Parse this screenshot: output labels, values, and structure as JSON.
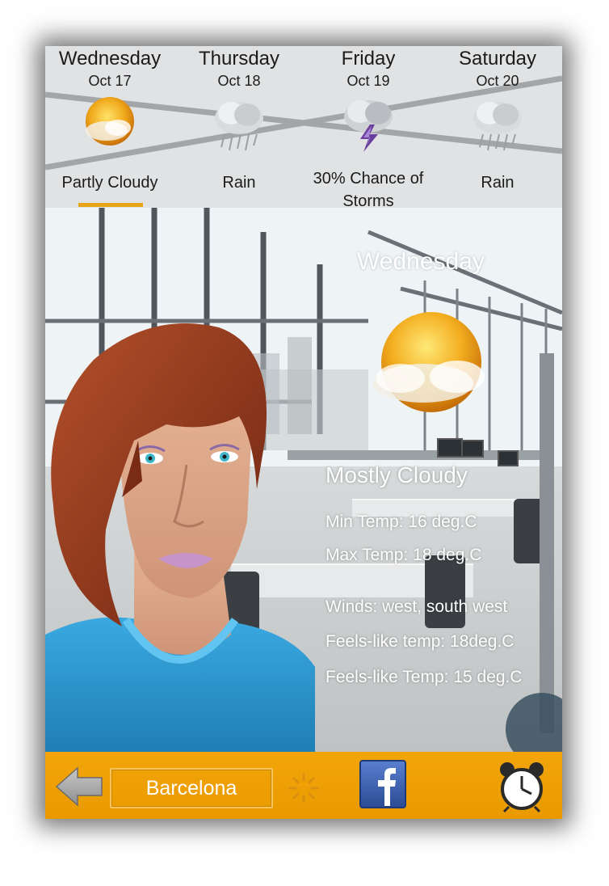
{
  "forecast": {
    "days": [
      {
        "name": "Wednesday",
        "date": "Oct 17",
        "condition": "Partly Cloudy",
        "icon": "partly-cloudy-icon"
      },
      {
        "name": "Thursday",
        "date": "Oct 18",
        "condition": "Rain",
        "icon": "rain-icon"
      },
      {
        "name": "Friday",
        "date": "Oct 19",
        "condition_line1": "30% Chance of",
        "condition_line2": "Storms",
        "icon": "thunderstorm-icon"
      },
      {
        "name": "Saturday",
        "date": "Oct 20",
        "condition": "Rain",
        "icon": "rain-icon"
      }
    ],
    "selected_index": 0,
    "accent_color": "#e8a317"
  },
  "detail": {
    "day": "Wednesday",
    "icon": "partly-cloudy-icon",
    "condition": "Mostly Cloudy",
    "min_temp": "Min Temp: 16 deg.C",
    "max_temp": "Max Temp: 18 deg.C",
    "winds": "Winds: west, south west",
    "feels_like_1": "Feels-like temp: 18deg.C",
    "feels_like_2": "Feels-like Temp: 15 deg.C"
  },
  "bottombar": {
    "city": "Barcelona",
    "back_icon": "back-arrow-icon",
    "spinner_icon": "loading-spinner-icon",
    "facebook_icon": "facebook-icon",
    "alarm_icon": "alarm-clock-icon",
    "color": "#f2a50a"
  }
}
